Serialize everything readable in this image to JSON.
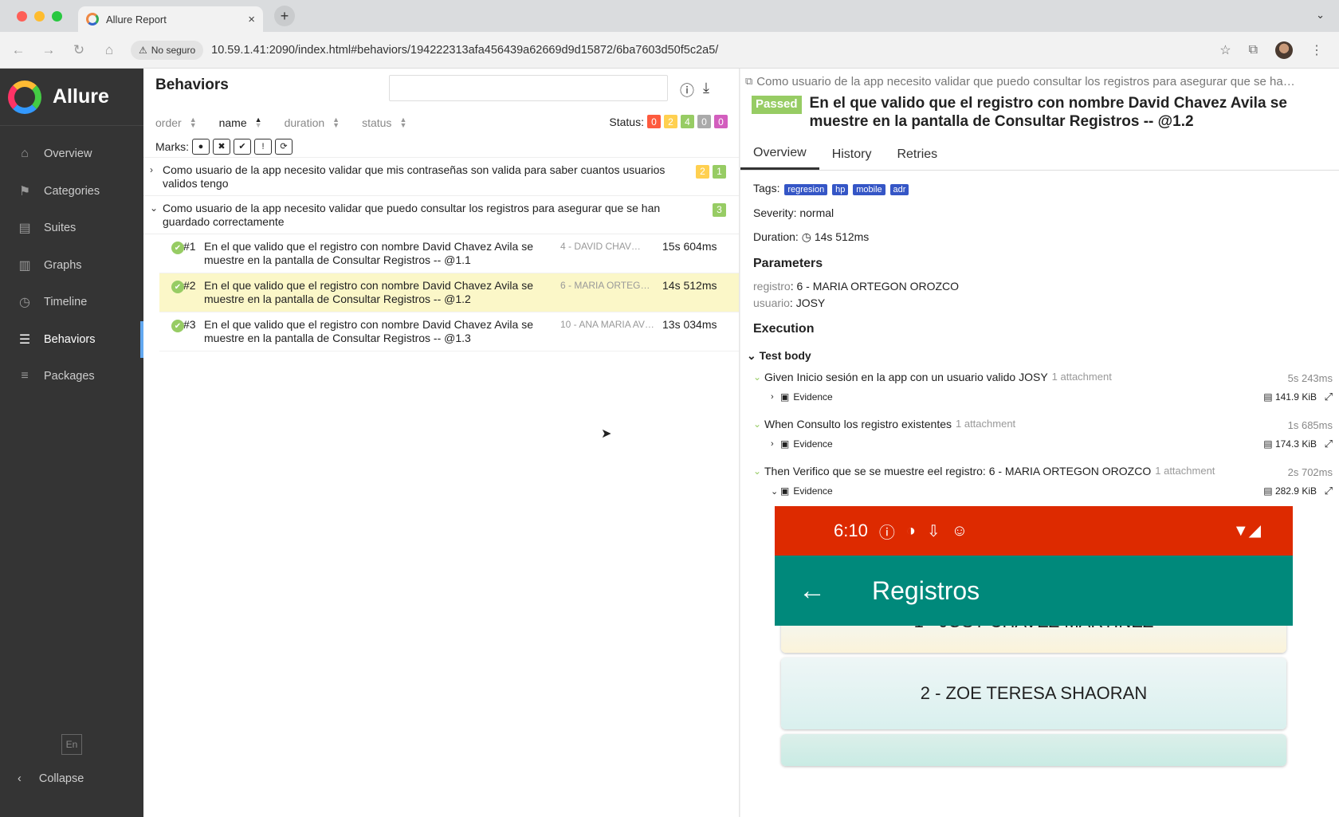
{
  "browser": {
    "tab_title": "Allure Report",
    "tab_close": "×",
    "new_tab": "+",
    "tab_menu": "⌄",
    "security_label": "No seguro",
    "url": "10.59.1.41:2090/index.html#behaviors/194222313afa456439a62669d9d15872/6ba7603d50f5c2a5/",
    "traffic_colors": [
      "#fe5f57",
      "#febc2e",
      "#28c840"
    ]
  },
  "sidebar": {
    "brand": "Allure",
    "items": [
      {
        "label": "Overview",
        "icon": "home-icon"
      },
      {
        "label": "Categories",
        "icon": "flag-icon"
      },
      {
        "label": "Suites",
        "icon": "briefcase-icon"
      },
      {
        "label": "Graphs",
        "icon": "bar-chart-icon"
      },
      {
        "label": "Timeline",
        "icon": "clock-icon"
      },
      {
        "label": "Behaviors",
        "icon": "list-icon",
        "active": true
      },
      {
        "label": "Packages",
        "icon": "align-left-icon"
      }
    ],
    "language": "En",
    "collapse": "Collapse"
  },
  "behaviors": {
    "title": "Behaviors",
    "sort": [
      "order",
      "name",
      "duration",
      "status"
    ],
    "status_label": "Status:",
    "status_counts": [
      {
        "value": "0",
        "color": "#fd5a3e"
      },
      {
        "value": "2",
        "color": "#ffd050"
      },
      {
        "value": "4",
        "color": "#97cc64"
      },
      {
        "value": "0",
        "color": "#aaaaaa"
      },
      {
        "value": "0",
        "color": "#d35ebe"
      }
    ],
    "marks_label": "Marks:",
    "groups": [
      {
        "title": "Como usuario de la app necesito validar que mis contraseñas son valida para saber cuantos usuarios validos tengo",
        "expanded": false,
        "badges": [
          {
            "value": "2",
            "color": "#ffd050"
          },
          {
            "value": "1",
            "color": "#97cc64"
          }
        ]
      },
      {
        "title": "Como usuario de la app necesito validar que puedo consultar los registros para asegurar que se han guardado correctamente",
        "expanded": true,
        "badges": [
          {
            "value": "3",
            "color": "#97cc64"
          }
        ]
      }
    ],
    "rows": [
      {
        "num": "#1",
        "name": "En el que valido que el registro con nombre David Chavez Avila se muestre en la pantalla de Consultar Registros -- @1.1",
        "param": "4 - DAVID CHAV…",
        "duration": "15s 604ms"
      },
      {
        "num": "#2",
        "name": "En el que valido que el registro con nombre David Chavez Avila se muestre en la pantalla de Consultar Registros -- @1.2",
        "param": "6 - MARIA ORTEGO…",
        "duration": "14s 512ms"
      },
      {
        "num": "#3",
        "name": "En el que valido que el registro con nombre David Chavez Avila se muestre en la pantalla de Consultar Registros -- @1.3",
        "param": "10 - ANA MARIA AVI…",
        "duration": "13s 034ms"
      }
    ]
  },
  "detail": {
    "breadcrumb": "Como usuario de la app necesito validar que puedo consultar los registros para asegurar que se ha…",
    "status": "Passed",
    "title": "En el que valido que el registro con nombre David Chavez Avila se muestre en la pantalla de Consultar Registros -- @1.2",
    "tabs": [
      "Overview",
      "History",
      "Retries"
    ],
    "tags_label": "Tags:",
    "tags": [
      "regresion",
      "hp",
      "mobile",
      "adr"
    ],
    "severity_label": "Severity:",
    "severity": "normal",
    "duration_label": "Duration:",
    "duration": "14s 512ms",
    "parameters_heading": "Parameters",
    "parameters": [
      {
        "key": "registro",
        "value": "6 - MARIA ORTEGON OROZCO"
      },
      {
        "key": "usuario",
        "value": "JOSY"
      }
    ],
    "execution_heading": "Execution",
    "test_body": "Test body",
    "steps": [
      {
        "name": "Given Inicio sesión en la app con un usuario valido JOSY",
        "attachments": "1 attachment",
        "duration": "5s 243ms",
        "evidence": "Evidence",
        "size": "141.9 KiB"
      },
      {
        "name": "When Consulto los registro existentes",
        "attachments": "1 attachment",
        "duration": "1s 685ms",
        "evidence": "Evidence",
        "size": "174.3 KiB"
      },
      {
        "name": "Then Verifico que se se muestre eel registro: 6 - MARIA ORTEGON OROZCO",
        "attachments": "1 attachment",
        "duration": "2s 702ms",
        "evidence": "Evidence",
        "size": "282.9 KiB"
      }
    ],
    "phone": {
      "time": "6:10",
      "title": "Registros",
      "cards": [
        "1 - JOSY CHAVEZ MARTINEZ",
        "2 - ZOE TERESA SHAORAN"
      ]
    }
  }
}
